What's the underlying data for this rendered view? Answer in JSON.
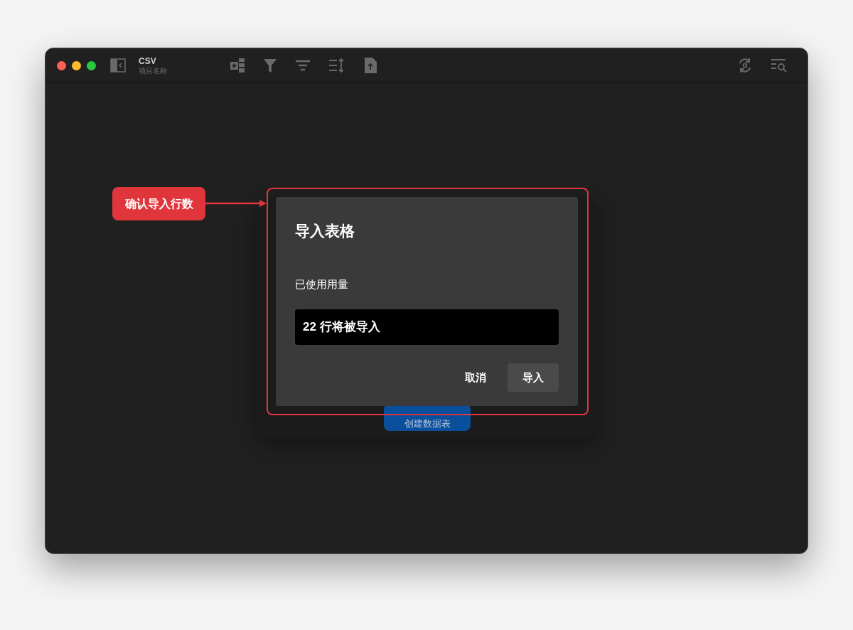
{
  "window": {
    "title": "CSV",
    "subtitle": "项目名称"
  },
  "background_button": {
    "label": "创建数据表"
  },
  "callout": {
    "label": "确认导入行数"
  },
  "dialog": {
    "title": "导入表格",
    "section_label": "已使用用量",
    "info": "22 行将被导入",
    "buttons": [
      {
        "label": "取消",
        "kind": "plain"
      },
      {
        "label": "导入",
        "kind": "filled"
      }
    ]
  }
}
